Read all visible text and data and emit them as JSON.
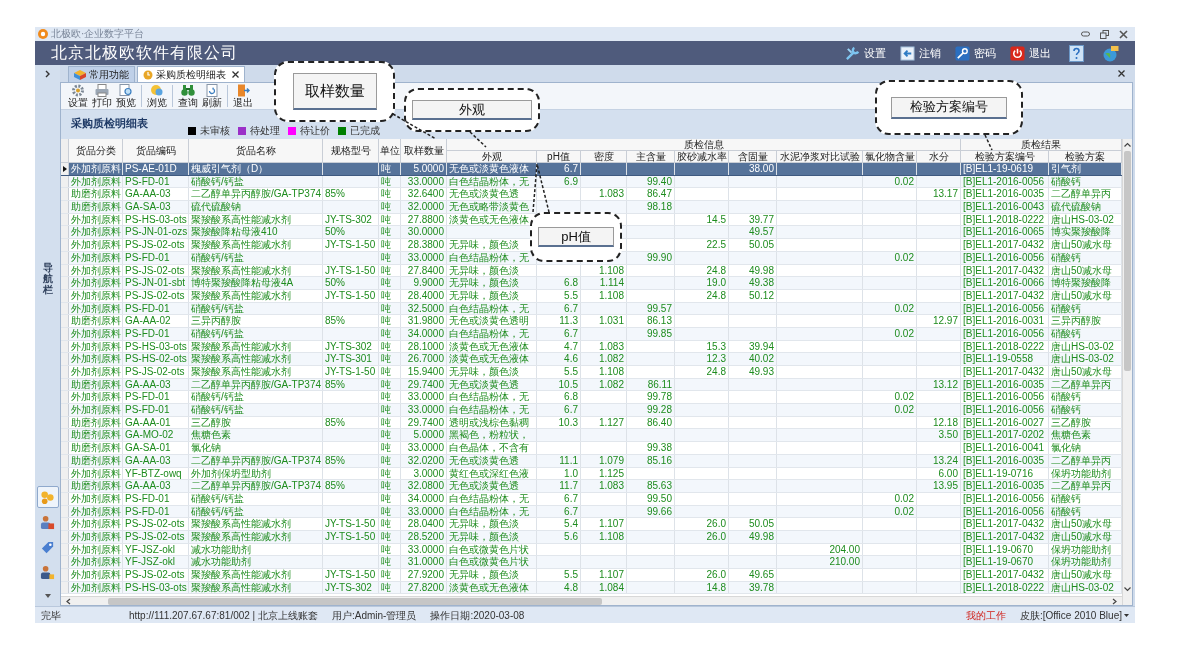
{
  "window": {
    "title": "北极欧·企业数字平台"
  },
  "company": "北京北极欧软件有限公司",
  "header_menu": [
    {
      "label": "设置",
      "kind": "settings"
    },
    {
      "label": "注销",
      "kind": "logout"
    },
    {
      "label": "密码",
      "kind": "password"
    },
    {
      "label": "退出",
      "kind": "exit"
    },
    {
      "kind": "help"
    },
    {
      "kind": "skin"
    }
  ],
  "sidebar": {
    "label": "导航栏",
    "nav_icons": [
      {
        "selected": true
      },
      {
        "selected": false
      },
      {
        "selected": false
      },
      {
        "selected": false
      }
    ]
  },
  "tabs": [
    {
      "label": "常用功能",
      "selected": false
    },
    {
      "label": "采购质检明细表",
      "selected": true
    }
  ],
  "toolbar": [
    {
      "label": "设置",
      "kind": "settings",
      "separator_after": false
    },
    {
      "label": "打印",
      "kind": "print",
      "separator_after": false
    },
    {
      "label": "预览",
      "kind": "preview",
      "separator_after": true
    },
    {
      "label": "浏览",
      "kind": "browse",
      "separator_after": true
    },
    {
      "label": "查询",
      "kind": "query",
      "separator_after": false
    },
    {
      "label": "刷新",
      "kind": "refresh",
      "separator_after": true
    },
    {
      "label": "退出",
      "kind": "exit",
      "separator_after": false
    }
  ],
  "report_title": "采购质检明细表",
  "legend": [
    {
      "label": "未审核",
      "color": "#000000"
    },
    {
      "label": "待处理",
      "color": "#9b30c8"
    },
    {
      "label": "待让价",
      "color": "#ff00ff"
    },
    {
      "label": "已完成",
      "color": "#008000"
    }
  ],
  "column_groups": [
    {
      "label": "质检信息"
    },
    {
      "label": "质检结果"
    }
  ],
  "columns": [
    {
      "label": "货品分类"
    },
    {
      "label": "货品编码"
    },
    {
      "label": "货品名称"
    },
    {
      "label": "规格型号"
    },
    {
      "label": "单位"
    },
    {
      "label": "取样数量"
    },
    {
      "label": "外观"
    },
    {
      "label": "pH值"
    },
    {
      "label": "密度"
    },
    {
      "label": "主含量"
    },
    {
      "label": "胶砂减水率"
    },
    {
      "label": "含固量"
    },
    {
      "label": "水泥净浆对比试验"
    },
    {
      "label": "氯化物含量"
    },
    {
      "label": "水分"
    },
    {
      "label": "检验方案编号"
    },
    {
      "label": "检验方案"
    }
  ],
  "rows": [
    {
      "selected": true,
      "cells": [
        "外加剂原料",
        "PS-AE-01D",
        "槐威引气剂（D）",
        null,
        "吨",
        "5.0000",
        "无色或淡黄色液体",
        "6.7",
        null,
        null,
        null,
        "38.00",
        null,
        null,
        null,
        "[B]EL1-19-0619",
        "引气剂"
      ]
    },
    {
      "selected": false,
      "cells": [
        "外加剂原料",
        "PS-FD-01",
        "硝酸钙/钙盐",
        null,
        "吨",
        "33.0000",
        "白色结晶粉体，无",
        "6.9",
        null,
        "99.40",
        null,
        null,
        null,
        "0.02",
        null,
        "[B]EL1-2016-0056",
        "硝酸钙"
      ]
    },
    {
      "selected": false,
      "cells": [
        "助磨剂原料",
        "GA-AA-03",
        "二乙醇单异丙醇胺/GA-TP374",
        "85%",
        "吨",
        "32.6400",
        "无色或淡黄色透",
        null,
        "1.083",
        "86.47",
        null,
        null,
        null,
        null,
        "13.17",
        "[B]EL1-2016-0035",
        "二乙醇单异丙"
      ]
    },
    {
      "selected": false,
      "cells": [
        "助磨剂原料",
        "GA-SA-03",
        "硫代硫酸钠",
        null,
        "吨",
        "32.0000",
        "无色或略带淡黄色",
        null,
        null,
        "98.18",
        null,
        null,
        null,
        null,
        null,
        "[B]EL1-2016-0043",
        "硫代硫酸钠"
      ]
    },
    {
      "selected": false,
      "cells": [
        "外加剂原料",
        "PS-HS-03-ots",
        "聚羧酸系高性能减水剂",
        "JY-TS-302",
        "吨",
        "27.8800",
        "淡黄色或无色液体",
        null,
        null,
        null,
        "14.5",
        "39.77",
        null,
        null,
        null,
        "[B]EL1-2018-0222",
        "唐山HS-03-02"
      ]
    },
    {
      "selected": false,
      "cells": [
        "外加剂原料",
        "PS-JN-01-ozs",
        "聚羧酸降粘母液410",
        "50%",
        "吨",
        "30.0000",
        null,
        null,
        null,
        null,
        null,
        "49.57",
        null,
        null,
        null,
        "[B]EL1-2016-0065",
        "博实聚羧酸降"
      ]
    },
    {
      "selected": false,
      "cells": [
        "外加剂原料",
        "PS-JS-02-ots",
        "聚羧酸系高性能减水剂",
        "JY-TS-1-50",
        "吨",
        "28.3800",
        "无异味，颜色淡",
        null,
        null,
        null,
        "22.5",
        "50.05",
        null,
        null,
        null,
        "[B]EL1-2017-0432",
        "唐山50减水母"
      ]
    },
    {
      "selected": false,
      "cells": [
        "外加剂原料",
        "PS-FD-01",
        "硝酸钙/钙盐",
        null,
        "吨",
        "33.0000",
        "白色结晶粉体，无",
        null,
        null,
        "99.90",
        null,
        null,
        null,
        "0.02",
        null,
        "[B]EL1-2016-0056",
        "硝酸钙"
      ]
    },
    {
      "selected": false,
      "cells": [
        "外加剂原料",
        "PS-JS-02-ots",
        "聚羧酸系高性能减水剂",
        "JY-TS-1-50",
        "吨",
        "27.8400",
        "无异味，颜色淡",
        null,
        "1.108",
        null,
        "24.8",
        "49.98",
        null,
        null,
        null,
        "[B]EL1-2017-0432",
        "唐山50减水母"
      ]
    },
    {
      "selected": false,
      "cells": [
        "外加剂原料",
        "PS-JN-01-sbt",
        "博特聚羧酸降粘母液4A",
        "50%",
        "吨",
        "9.9000",
        "无异味，颜色淡",
        "6.8",
        "1.114",
        null,
        "19.0",
        "49.38",
        null,
        null,
        null,
        "[B]EL1-2016-0066",
        "博特聚羧酸降"
      ]
    },
    {
      "selected": false,
      "cells": [
        "外加剂原料",
        "PS-JS-02-ots",
        "聚羧酸系高性能减水剂",
        "JY-TS-1-50",
        "吨",
        "28.4000",
        "无异味，颜色淡",
        "5.5",
        "1.108",
        null,
        "24.8",
        "50.12",
        null,
        null,
        null,
        "[B]EL1-2017-0432",
        "唐山50减水母"
      ]
    },
    {
      "selected": false,
      "cells": [
        "外加剂原料",
        "PS-FD-01",
        "硝酸钙/钙盐",
        null,
        "吨",
        "32.5000",
        "白色结晶粉体，无",
        "6.7",
        null,
        "99.57",
        null,
        null,
        null,
        "0.02",
        null,
        "[B]EL1-2016-0056",
        "硝酸钙"
      ]
    },
    {
      "selected": false,
      "cells": [
        "助磨剂原料",
        "GA-AA-02",
        "三异丙醇胺",
        "85%",
        "吨",
        "31.9800",
        "无色或淡黄色透明",
        "11.3",
        "1.031",
        "86.13",
        null,
        null,
        null,
        null,
        "12.97",
        "[B]EL1-2016-0031",
        "三异丙醇胺"
      ]
    },
    {
      "selected": false,
      "cells": [
        "外加剂原料",
        "PS-FD-01",
        "硝酸钙/钙盐",
        null,
        "吨",
        "34.0000",
        "白色结晶粉体，无",
        "6.7",
        null,
        "99.85",
        null,
        null,
        null,
        "0.02",
        null,
        "[B]EL1-2016-0056",
        "硝酸钙"
      ]
    },
    {
      "selected": false,
      "cells": [
        "外加剂原料",
        "PS-HS-03-ots",
        "聚羧酸系高性能减水剂",
        "JY-TS-302",
        "吨",
        "28.1000",
        "淡黄色或无色液体",
        "4.7",
        "1.083",
        null,
        "15.3",
        "39.94",
        null,
        null,
        null,
        "[B]EL1-2018-0222",
        "唐山HS-03-02"
      ]
    },
    {
      "selected": false,
      "cells": [
        "外加剂原料",
        "PS-HS-02-ots",
        "聚羧酸系高性能减水剂",
        "JY-TS-301",
        "吨",
        "26.7000",
        "淡黄色或无色液体",
        "4.6",
        "1.082",
        null,
        "12.3",
        "40.02",
        null,
        null,
        null,
        "[B]EL1-19-0558",
        "唐山HS-03-02"
      ]
    },
    {
      "selected": false,
      "cells": [
        "外加剂原料",
        "PS-JS-02-ots",
        "聚羧酸系高性能减水剂",
        "JY-TS-1-50",
        "吨",
        "15.9400",
        "无异味，颜色淡",
        "5.5",
        "1.108",
        null,
        "24.8",
        "49.93",
        null,
        null,
        null,
        "[B]EL1-2017-0432",
        "唐山50减水母"
      ]
    },
    {
      "selected": false,
      "cells": [
        "助磨剂原料",
        "GA-AA-03",
        "二乙醇单异丙醇胺/GA-TP374",
        "85%",
        "吨",
        "29.7400",
        "无色或淡黄色透",
        "10.5",
        "1.082",
        "86.11",
        null,
        null,
        null,
        null,
        "13.12",
        "[B]EL1-2016-0035",
        "二乙醇单异丙"
      ]
    },
    {
      "selected": false,
      "cells": [
        "外加剂原料",
        "PS-FD-01",
        "硝酸钙/钙盐",
        null,
        "吨",
        "33.0000",
        "白色结晶粉体，无",
        "6.8",
        null,
        "99.78",
        null,
        null,
        null,
        "0.02",
        null,
        "[B]EL1-2016-0056",
        "硝酸钙"
      ]
    },
    {
      "selected": false,
      "cells": [
        "外加剂原料",
        "PS-FD-01",
        "硝酸钙/钙盐",
        null,
        "吨",
        "33.0000",
        "白色结晶粉体，无",
        "6.7",
        null,
        "99.28",
        null,
        null,
        null,
        "0.02",
        null,
        "[B]EL1-2016-0056",
        "硝酸钙"
      ]
    },
    {
      "selected": false,
      "cells": [
        "助磨剂原料",
        "GA-AA-01",
        "三乙醇胺",
        "85%",
        "吨",
        "29.7400",
        "透明或浅棕色黏稠",
        "10.3",
        "1.127",
        "86.40",
        null,
        null,
        null,
        null,
        "12.18",
        "[B]EL1-2016-0027",
        "三乙醇胺"
      ]
    },
    {
      "selected": false,
      "cells": [
        "助磨剂原料",
        "GA-MO-02",
        "焦糖色素",
        null,
        "吨",
        "5.0000",
        "黑褐色，粉粒状，",
        null,
        null,
        null,
        null,
        null,
        null,
        null,
        "3.50",
        "[B]EL1-2017-0202",
        "焦糖色素"
      ]
    },
    {
      "selected": false,
      "cells": [
        "助磨剂原料",
        "GA-SA-01",
        "氯化钠",
        null,
        "吨",
        "33.0000",
        "白色晶体，不含有",
        null,
        null,
        "99.38",
        null,
        null,
        null,
        null,
        null,
        "[B]EL1-2016-0041",
        "氯化钠"
      ]
    },
    {
      "selected": false,
      "cells": [
        "助磨剂原料",
        "GA-AA-03",
        "二乙醇单异丙醇胺/GA-TP374",
        "85%",
        "吨",
        "32.0200",
        "无色或淡黄色透",
        "11.1",
        "1.079",
        "85.16",
        null,
        null,
        null,
        null,
        "13.24",
        "[B]EL1-2016-0035",
        "二乙醇单异丙"
      ]
    },
    {
      "selected": false,
      "cells": [
        "外加剂原料",
        "YF-BTZ-owq",
        "外加剂保坍型助剂",
        null,
        "吨",
        "3.0000",
        "黄红色或深红色液",
        "1.0",
        "1.125",
        null,
        null,
        null,
        null,
        null,
        "6.00",
        "[B]EL1-19-0716",
        "保坍功能助剂"
      ]
    },
    {
      "selected": false,
      "cells": [
        "助磨剂原料",
        "GA-AA-03",
        "二乙醇单异丙醇胺/GA-TP374",
        "85%",
        "吨",
        "32.0800",
        "无色或淡黄色透",
        "11.7",
        "1.083",
        "85.63",
        null,
        null,
        null,
        null,
        "13.95",
        "[B]EL1-2016-0035",
        "二乙醇单异丙"
      ]
    },
    {
      "selected": false,
      "cells": [
        "外加剂原料",
        "PS-FD-01",
        "硝酸钙/钙盐",
        null,
        "吨",
        "34.0000",
        "白色结晶粉体，无",
        "6.7",
        null,
        "99.50",
        null,
        null,
        null,
        "0.02",
        null,
        "[B]EL1-2016-0056",
        "硝酸钙"
      ]
    },
    {
      "selected": false,
      "cells": [
        "外加剂原料",
        "PS-FD-01",
        "硝酸钙/钙盐",
        null,
        "吨",
        "33.0000",
        "白色结晶粉体，无",
        "6.7",
        null,
        "99.66",
        null,
        null,
        null,
        "0.02",
        null,
        "[B]EL1-2016-0056",
        "硝酸钙"
      ]
    },
    {
      "selected": false,
      "cells": [
        "外加剂原料",
        "PS-JS-02-ots",
        "聚羧酸系高性能减水剂",
        "JY-TS-1-50",
        "吨",
        "28.0400",
        "无异味，颜色淡",
        "5.4",
        "1.107",
        null,
        "26.0",
        "50.05",
        null,
        null,
        null,
        "[B]EL1-2017-0432",
        "唐山50减水母"
      ]
    },
    {
      "selected": false,
      "cells": [
        "外加剂原料",
        "PS-JS-02-ots",
        "聚羧酸系高性能减水剂",
        "JY-TS-1-50",
        "吨",
        "28.5200",
        "无异味，颜色淡",
        "5.6",
        "1.108",
        null,
        "26.0",
        "49.98",
        null,
        null,
        null,
        "[B]EL1-2017-0432",
        "唐山50减水母"
      ]
    },
    {
      "selected": false,
      "cells": [
        "外加剂原料",
        "YF-JSZ-okl",
        "减水功能助剂",
        null,
        "吨",
        "33.0000",
        "白色或微黄色片状",
        null,
        null,
        null,
        null,
        null,
        "204.00",
        null,
        null,
        "[B]EL1-19-0670",
        "保坍功能助剂"
      ]
    },
    {
      "selected": false,
      "cells": [
        "外加剂原料",
        "YF-JSZ-okl",
        "减水功能助剂",
        null,
        "吨",
        "31.0000",
        "白色或微黄色片状",
        null,
        null,
        null,
        null,
        null,
        "210.00",
        null,
        null,
        "[B]EL1-19-0670",
        "保坍功能助剂"
      ]
    },
    {
      "selected": false,
      "cells": [
        "外加剂原料",
        "PS-JS-02-ots",
        "聚羧酸系高性能减水剂",
        "JY-TS-1-50",
        "吨",
        "27.9200",
        "无异味，颜色淡",
        "5.5",
        "1.107",
        null,
        "26.0",
        "49.65",
        null,
        null,
        null,
        "[B]EL1-2017-0432",
        "唐山50减水母"
      ]
    },
    {
      "selected": false,
      "cells": [
        "外加剂原料",
        "PS-HS-03-ots",
        "聚羧酸系高性能减水剂",
        "JY-TS-302",
        "吨",
        "27.8200",
        "淡黄色或无色液体",
        "4.8",
        "1.084",
        null,
        "14.8",
        "39.78",
        null,
        null,
        null,
        "[B]EL1-2018-0222",
        "唐山HS-03-02"
      ]
    }
  ],
  "callouts": [
    {
      "label": "取样数量"
    },
    {
      "label": "外观"
    },
    {
      "label": "检验方案编号"
    },
    {
      "label": "pH值"
    }
  ],
  "status_bar": [
    {
      "label": "完毕",
      "kind": "text"
    },
    {
      "label": "http://111.207.67.67:81/002 | 北京上线账套",
      "kind": "text"
    },
    {
      "label": "用户:Admin-管理员",
      "kind": "text"
    },
    {
      "label": "操作日期:2020-03-08",
      "kind": "text"
    },
    {
      "label": "我的工作",
      "kind": "link"
    },
    {
      "label": "皮肤:[Office 2010 Blue]",
      "kind": "menu"
    }
  ]
}
